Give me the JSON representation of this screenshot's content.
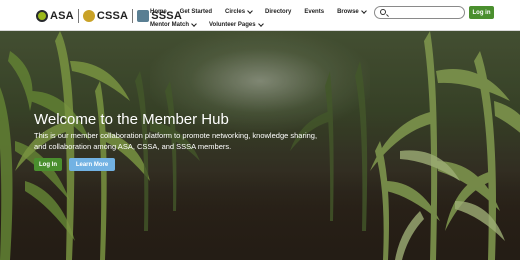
{
  "header": {
    "logos": [
      "ASA",
      "CSSA",
      "SSSA"
    ],
    "nav_row1": [
      {
        "label": "Home",
        "dropdown": false
      },
      {
        "label": "Get Started",
        "dropdown": false
      },
      {
        "label": "Circles",
        "dropdown": true
      },
      {
        "label": "Directory",
        "dropdown": false
      },
      {
        "label": "Events",
        "dropdown": false
      },
      {
        "label": "Browse",
        "dropdown": true
      }
    ],
    "nav_row2": [
      {
        "label": "Mentor Match",
        "dropdown": true
      },
      {
        "label": "Volunteer Pages",
        "dropdown": true
      }
    ],
    "search": {
      "value": "",
      "placeholder": ""
    },
    "login_label": "Log in"
  },
  "hero": {
    "title": "Welcome to the Member Hub",
    "description": "This is our member collaboration platform to promote networking, knowledge sharing, and collaboration among ASA, CSSA, and SSSA members.",
    "login_label": "Log In",
    "learn_more_label": "Learn More"
  },
  "colors": {
    "primary_green": "#4a8f2e",
    "learn_more_blue": "#72b2e3"
  }
}
